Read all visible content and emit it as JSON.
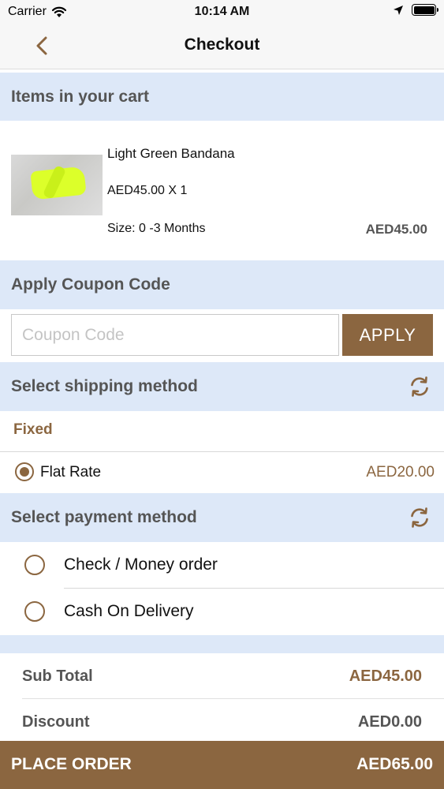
{
  "status_bar": {
    "carrier": "Carrier",
    "time": "10:14 AM"
  },
  "nav": {
    "title": "Checkout"
  },
  "cart_section": {
    "title": "Items in your cart",
    "item": {
      "name": "Light Green Bandana",
      "price_qty": "AED45.00 X 1",
      "size": "Size: 0 -3 Months",
      "total": "AED45.00"
    }
  },
  "coupon_section": {
    "title": "Apply Coupon Code",
    "placeholder": "Coupon Code",
    "apply_label": "APPLY"
  },
  "shipping_section": {
    "title": "Select shipping method",
    "group": "Fixed",
    "option": {
      "name": "Flat Rate",
      "price": "AED20.00",
      "selected": true
    }
  },
  "payment_section": {
    "title": "Select payment method",
    "options": [
      {
        "name": "Check / Money order",
        "selected": false
      },
      {
        "name": "Cash On Delivery",
        "selected": false
      }
    ]
  },
  "summary": {
    "sub_total_label": "Sub Total",
    "sub_total_value": "AED45.00",
    "discount_label": "Discount",
    "discount_value": "AED0.00"
  },
  "place_order": {
    "label": "PLACE ORDER",
    "amount": "AED65.00"
  },
  "colors": {
    "accent": "#8b6640",
    "section_bg": "#dde8f8",
    "product_color": "#dcff2a"
  }
}
